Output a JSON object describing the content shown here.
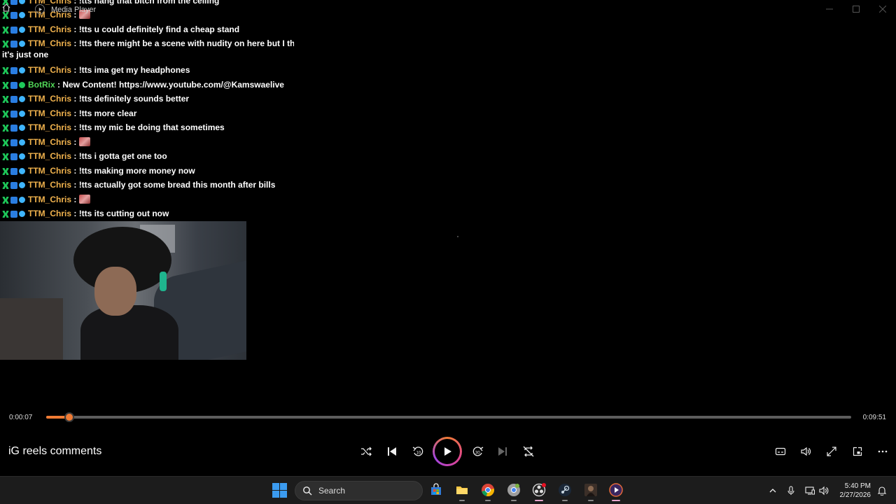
{
  "window": {
    "title": "Media Player",
    "controls": [
      "minimize",
      "maximize",
      "close"
    ]
  },
  "chat": {
    "messages": [
      {
        "user": "TTM_Chris",
        "text": "!tts hang that bitch from the ceiling",
        "emote": false,
        "bot": false
      },
      {
        "user": "TTM_Chris",
        "text": "",
        "emote": true,
        "bot": false
      },
      {
        "user": "TTM_Chris",
        "text": "!tts u could definitely find a cheap stand",
        "emote": false,
        "bot": false
      },
      {
        "user": "TTM_Chris",
        "text": "!tts there might be a scene with nudity on here but I think",
        "emote": false,
        "bot": false
      },
      {
        "user": "TTM_Chris",
        "text": "!tts ima get my headphones",
        "emote": false,
        "bot": false
      },
      {
        "user": "BotRix",
        "text": "New Content! https://www.youtube.com/@Kamswaelive",
        "emote": false,
        "bot": true
      },
      {
        "user": "TTM_Chris",
        "text": "!tts definitely sounds better",
        "emote": false,
        "bot": false
      },
      {
        "user": "TTM_Chris",
        "text": "!tts more clear",
        "emote": false,
        "bot": false
      },
      {
        "user": "TTM_Chris",
        "text": "!tts my mic be doing that sometimes",
        "emote": false,
        "bot": false
      },
      {
        "user": "TTM_Chris",
        "text": "",
        "emote": true,
        "bot": false
      },
      {
        "user": "TTM_Chris",
        "text": "!tts i gotta get one too",
        "emote": false,
        "bot": false
      },
      {
        "user": "TTM_Chris",
        "text": "!tts making more money now",
        "emote": false,
        "bot": false
      },
      {
        "user": "TTM_Chris",
        "text": "!tts actually got some bread this month after bills",
        "emote": false,
        "bot": false
      },
      {
        "user": "TTM_Chris",
        "text": "",
        "emote": true,
        "bot": false
      },
      {
        "user": "TTM_Chris",
        "text": "!tts its cutting out now",
        "emote": false,
        "bot": false
      }
    ],
    "wrap_text": "it's just one",
    "separator": " : "
  },
  "player": {
    "current_time": "0:00:07",
    "total_time": "0:09:51",
    "progress": 0.0118,
    "media_title": "iG reels comments",
    "accent": "#f07b34"
  },
  "taskbar": {
    "search_label": "Search",
    "time": "5:40 PM",
    "date": "2/27/2026",
    "apps": [
      "microsoft-store-icon",
      "file-explorer-icon",
      "chrome-icon",
      "chrome-canary-icon",
      "obs-icon",
      "steam-icon",
      "game-icon",
      "media-player-icon"
    ]
  }
}
